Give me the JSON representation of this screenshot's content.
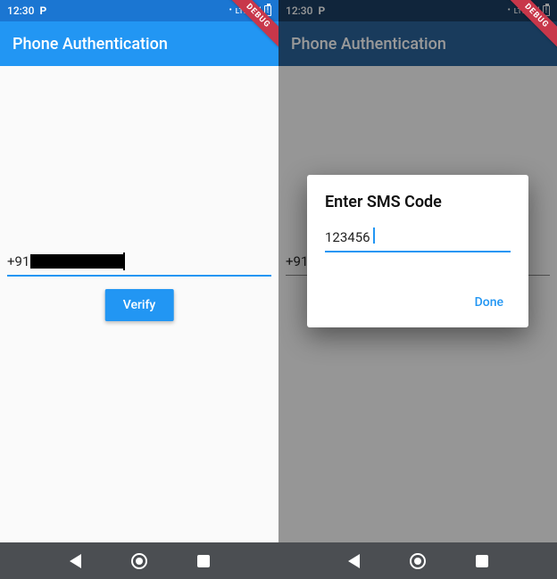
{
  "status": {
    "time": "12:30",
    "carrier_icon": "P",
    "lte": "LTE",
    "battery_icon": "battery-charging"
  },
  "appbar": {
    "title": "Phone Authentication"
  },
  "debug_ribbon": "DEBUG",
  "left_screen": {
    "phone_prefix": "+91",
    "verify_label": "Verify"
  },
  "right_screen": {
    "phone_prefix": "+91",
    "dialog": {
      "title": "Enter SMS Code",
      "code_value": "123456",
      "done_label": "Done"
    }
  },
  "nav": {
    "back": "back",
    "home": "home",
    "recents": "recents"
  }
}
